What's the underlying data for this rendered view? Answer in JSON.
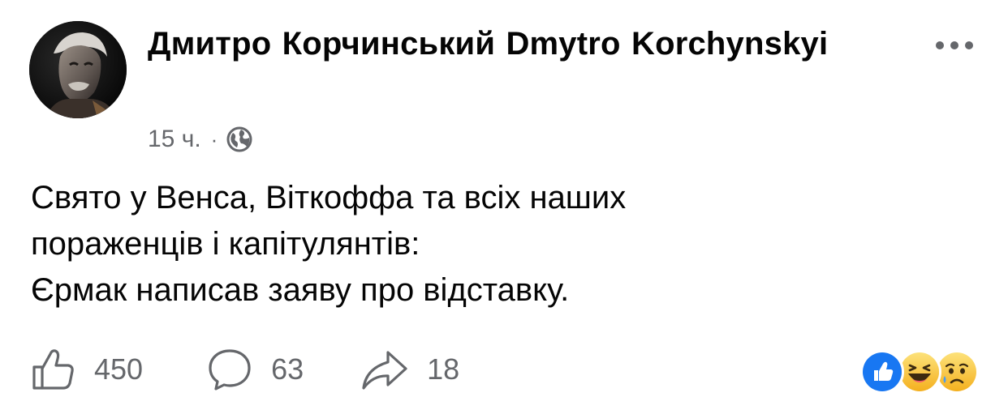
{
  "post": {
    "author": {
      "name": "Дмитро Корчинський   Dmytro Korchynskyi"
    },
    "timestamp": "15 ч.",
    "separator": "·",
    "privacy_icon": "globe-icon",
    "more_icon": "more-horizontal-icon",
    "body_lines": [
      "Свято у Венса, Віткоффа та всіх наших",
      "пораженців і капітулянтів:",
      "Єрмак написав заяву про відставку."
    ]
  },
  "actions": {
    "like": {
      "icon": "thumbs-up-icon",
      "count": "450"
    },
    "comment": {
      "icon": "comment-bubble-icon",
      "count": "63"
    },
    "share": {
      "icon": "share-arrow-icon",
      "count": "18"
    }
  },
  "reactions": [
    {
      "icon": "like-reaction-icon",
      "color": "#1877f2"
    },
    {
      "icon": "haha-reaction-icon",
      "color": "#f7b125"
    },
    {
      "icon": "sad-reaction-icon",
      "color": "#f7b125"
    }
  ],
  "colors": {
    "text_primary": "#050505",
    "text_secondary": "#65676b",
    "accent_blue": "#1877f2",
    "emoji_yellow": "#f7b125"
  }
}
